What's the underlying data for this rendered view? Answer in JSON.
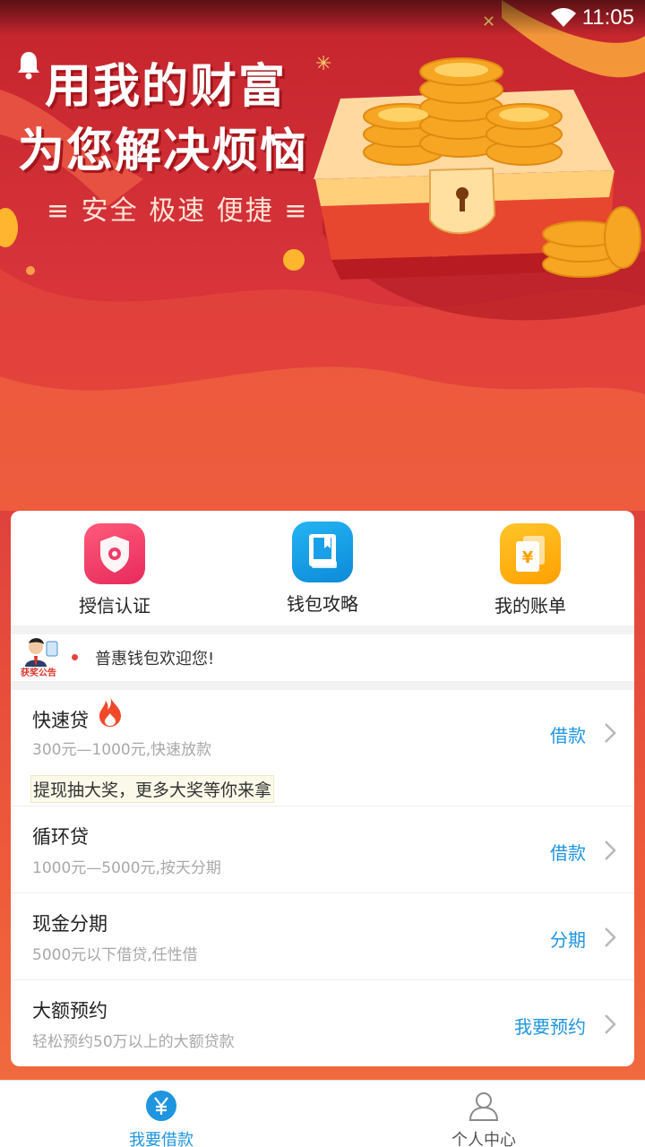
{
  "status_bar": {
    "time": "11:05"
  },
  "hero": {
    "title_line1": "用我的财富",
    "title_line2": "为您解决烦恼",
    "tagline": "≡ 安全  极速  便捷 ≡"
  },
  "quick_actions": [
    {
      "label": "授信认证",
      "icon": "shield-icon",
      "color": "#f03e68"
    },
    {
      "label": "钱包攻略",
      "icon": "book-icon",
      "color": "#1aa0e8"
    },
    {
      "label": "我的账单",
      "icon": "bill-icon",
      "color": "#ffb310"
    }
  ],
  "notice": {
    "badge": "获奖公告",
    "text": "普惠钱包欢迎您!"
  },
  "loans": [
    {
      "name": "快速贷",
      "desc": "300元—1000元,快速放款",
      "action": "借款",
      "promo": "提现抽大奖，更多大奖等你来拿"
    },
    {
      "name": "循环贷",
      "desc": "1000元—5000元,按天分期",
      "action": "借款"
    },
    {
      "name": "现金分期",
      "desc": "5000元以下借贷,任性借",
      "action": "分期"
    },
    {
      "name": "大额预约",
      "desc": "轻松预约50万以上的大额贷款",
      "action": "我要预约"
    }
  ],
  "bottom_nav": [
    {
      "label": "我要借款",
      "icon": "yen-icon",
      "active": true
    },
    {
      "label": "个人中心",
      "icon": "person-icon",
      "active": false
    }
  ],
  "colors": {
    "accent": "#1f95df",
    "hero_red": "#d7333a",
    "notice_dot": "#e8413c"
  }
}
